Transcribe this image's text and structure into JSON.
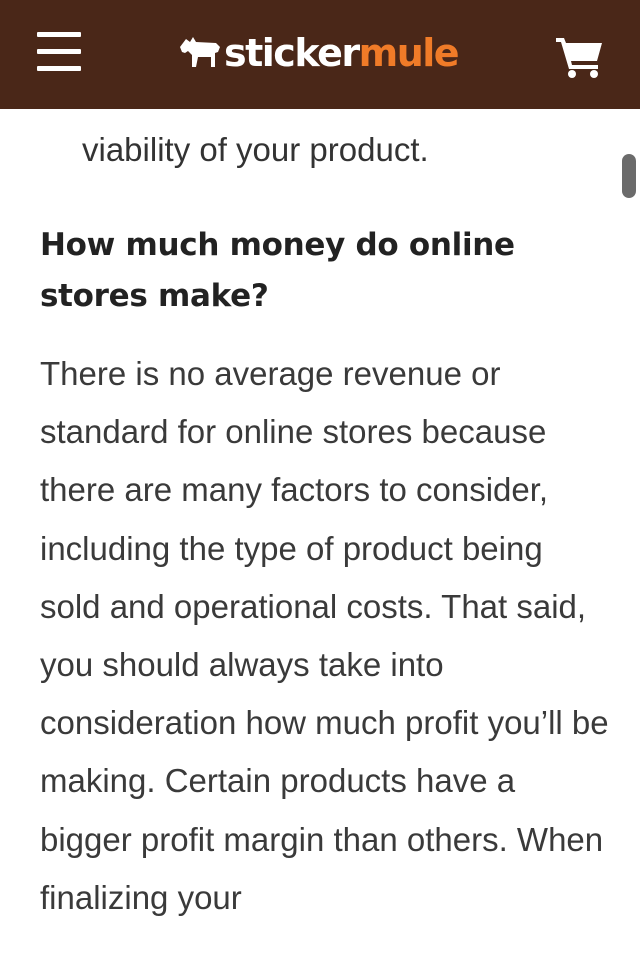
{
  "header": {
    "brand_primary": "sticker",
    "brand_secondary": "mule",
    "icons": {
      "menu": "hamburger-menu-icon",
      "logo": "mule-logo-icon",
      "cart": "shopping-cart-icon"
    },
    "colors": {
      "background": "#4a2718",
      "brand_accent": "#f07b28",
      "foreground": "#ffffff"
    }
  },
  "article": {
    "previous_paragraph_tail": "viability of your product.",
    "heading": "How much money do online stores make?",
    "paragraph": "There is no average revenue or standard for online stores because there are many factors to consider, including the type of product being sold and operational costs. That said, you should always take into consideration how much profit you’ll be making. Certain products have a bigger profit margin than others. When finalizing your"
  }
}
